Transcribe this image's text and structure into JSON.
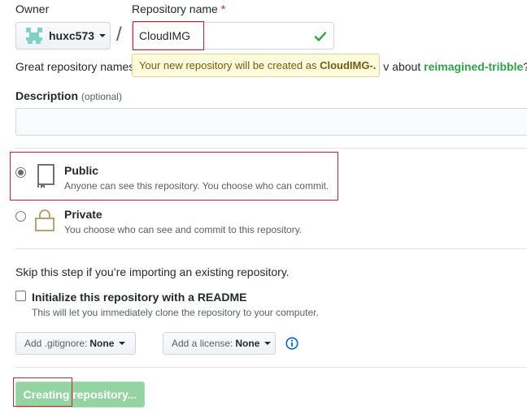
{
  "owner": {
    "label": "Owner",
    "value": "huxc573"
  },
  "repo_name": {
    "label": "Repository name",
    "required_mark": "*",
    "value": "CloudIMG",
    "slash": "/"
  },
  "hint": {
    "prefix": "Great repository names",
    "suffix": "v about",
    "suggestion": "reimagined-tribble",
    "end": "?"
  },
  "tooltip": {
    "text": "Your new repository will be created as",
    "name": "CloudIMG-."
  },
  "description": {
    "label": "Description",
    "optional": "(optional)",
    "value": ""
  },
  "visibility": {
    "public": {
      "title": "Public",
      "note": "Anyone can see this repository. You choose who can commit.",
      "checked": true
    },
    "private": {
      "title": "Private",
      "note": "You choose who can see and commit to this repository.",
      "checked": false
    }
  },
  "skip_text": "Skip this step if you’re importing an existing repository.",
  "readme": {
    "label": "Initialize this repository with a README",
    "note": "This will let you immediately clone the repository to your computer.",
    "checked": false
  },
  "gitignore": {
    "label": "Add .gitignore:",
    "value": "None"
  },
  "license": {
    "label": "Add a license:",
    "value": "None"
  },
  "submit": {
    "label": "Creating repository..."
  },
  "colors": {
    "accent_green": "#28a745",
    "highlight_red": "#d0202a",
    "tooltip_bg": "#fffbdd",
    "disabled_button": "#94d3a2"
  },
  "icons": [
    "avatar-icon",
    "check-icon",
    "repo-book-icon",
    "lock-icon",
    "info-icon",
    "caret-down-icon"
  ]
}
